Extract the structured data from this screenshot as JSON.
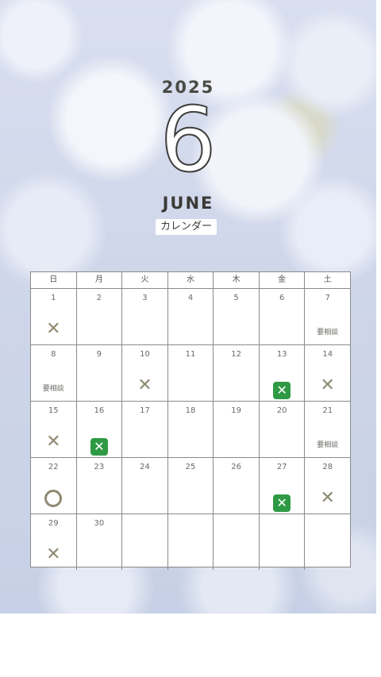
{
  "header": {
    "year": "2025",
    "month_number": "6",
    "month_name": "JUNE",
    "label": "カレンダー"
  },
  "weekdays": [
    "日",
    "月",
    "火",
    "水",
    "木",
    "金",
    "土"
  ],
  "weeks": [
    [
      {
        "day": "1",
        "mark": "x"
      },
      {
        "day": "2",
        "mark": ""
      },
      {
        "day": "3",
        "mark": ""
      },
      {
        "day": "4",
        "mark": ""
      },
      {
        "day": "5",
        "mark": ""
      },
      {
        "day": "6",
        "mark": ""
      },
      {
        "day": "7",
        "mark": "要相談"
      }
    ],
    [
      {
        "day": "8",
        "mark": "要相談"
      },
      {
        "day": "9",
        "mark": ""
      },
      {
        "day": "10",
        "mark": "x"
      },
      {
        "day": "11",
        "mark": ""
      },
      {
        "day": "12",
        "mark": ""
      },
      {
        "day": "13",
        "mark": "green-x"
      },
      {
        "day": "14",
        "mark": "x"
      }
    ],
    [
      {
        "day": "15",
        "mark": "x"
      },
      {
        "day": "16",
        "mark": "green-x"
      },
      {
        "day": "17",
        "mark": ""
      },
      {
        "day": "18",
        "mark": ""
      },
      {
        "day": "19",
        "mark": ""
      },
      {
        "day": "20",
        "mark": ""
      },
      {
        "day": "21",
        "mark": "要相談"
      }
    ],
    [
      {
        "day": "22",
        "mark": "circle"
      },
      {
        "day": "23",
        "mark": ""
      },
      {
        "day": "24",
        "mark": ""
      },
      {
        "day": "25",
        "mark": ""
      },
      {
        "day": "26",
        "mark": ""
      },
      {
        "day": "27",
        "mark": "green-x"
      },
      {
        "day": "28",
        "mark": "x"
      }
    ],
    [
      {
        "day": "29",
        "mark": "x"
      },
      {
        "day": "30",
        "mark": ""
      },
      {
        "day": "",
        "mark": ""
      },
      {
        "day": "",
        "mark": ""
      },
      {
        "day": "",
        "mark": ""
      },
      {
        "day": "",
        "mark": ""
      },
      {
        "day": "",
        "mark": ""
      }
    ]
  ],
  "colors": {
    "mark_gray": "#8f8a72",
    "mark_green": "#2f9a44",
    "border": "#8a8a88"
  }
}
